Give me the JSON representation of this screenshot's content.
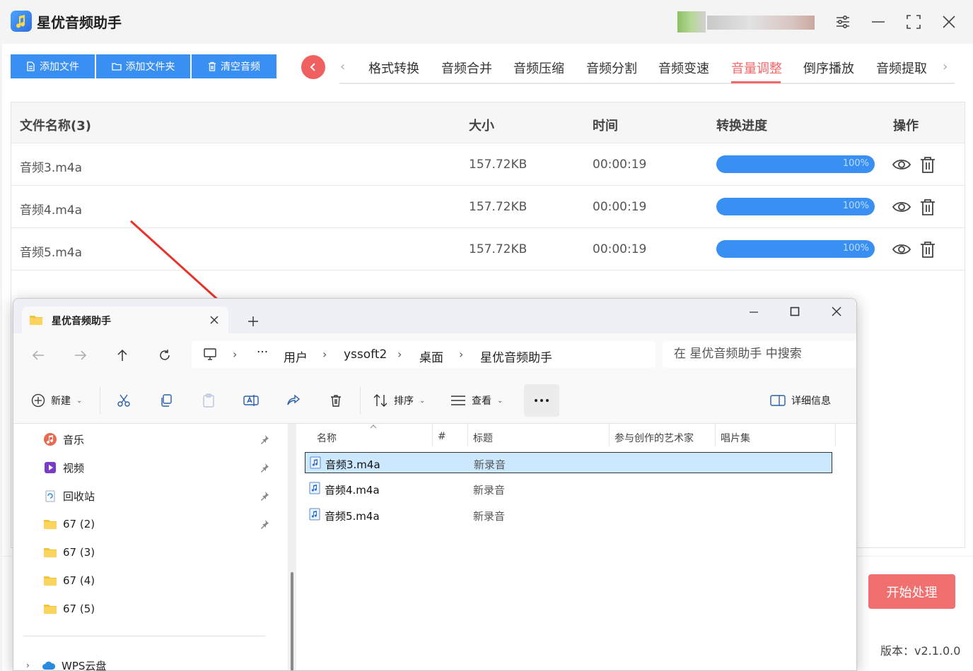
{
  "app": {
    "title": "星优音频助手",
    "toolbar": {
      "add_file": "添加文件",
      "add_folder": "添加文件夹",
      "clear_audio": "清空音频"
    },
    "tabs": [
      "格式转换",
      "音频合并",
      "音频压缩",
      "音频分割",
      "音频变速",
      "音量调整",
      "倒序播放",
      "音频提取"
    ],
    "active_tab": "音量调整",
    "table": {
      "headers": {
        "name": "文件名称(3)",
        "size": "大小",
        "time": "时间",
        "progress": "转换进度",
        "actions": "操作"
      },
      "rows": [
        {
          "name": "音频3.m4a",
          "size": "157.72KB",
          "time": "00:00:19",
          "progress_text": "100%",
          "progress": 1.0
        },
        {
          "name": "音频4.m4a",
          "size": "157.72KB",
          "time": "00:00:19",
          "progress_text": "100%",
          "progress": 1.0
        },
        {
          "name": "音频5.m4a",
          "size": "157.72KB",
          "time": "00:00:19",
          "progress_text": "100%",
          "progress": 1.0
        }
      ]
    },
    "start_button": "开始处理",
    "version": "版本：v2.1.0.0",
    "colors": {
      "primary": "#3a8ff2",
      "accent": "#f06868"
    }
  },
  "explorer": {
    "tab_title": "星优音频助手",
    "breadcrumb": [
      "用户",
      "yssoft2",
      "桌面",
      "星优音频助手"
    ],
    "breadcrumb_ellipsis": "···",
    "search_placeholder": "在 星优音频助手 中搜索",
    "toolbar": {
      "new": "新建",
      "sort": "排序",
      "view": "查看",
      "details": "详细信息"
    },
    "nav_items": [
      {
        "label": "音乐",
        "icon": "music-icon",
        "pinned": true
      },
      {
        "label": "视频",
        "icon": "video-icon",
        "pinned": true
      },
      {
        "label": "回收站",
        "icon": "recycle-bin-icon",
        "pinned": true
      },
      {
        "label": "67 (2)",
        "icon": "folder-icon",
        "pinned": true
      },
      {
        "label": "67 (3)",
        "icon": "folder-icon",
        "pinned": false
      },
      {
        "label": "67 (4)",
        "icon": "folder-icon",
        "pinned": false
      },
      {
        "label": "67 (5)",
        "icon": "folder-icon",
        "pinned": false
      }
    ],
    "nav_cloud": "WPS云盘",
    "columns": [
      "名称",
      "#",
      "标题",
      "参与创作的艺术家",
      "唱片集"
    ],
    "files": [
      {
        "name": "音频3.m4a",
        "title": "新录音",
        "selected": true
      },
      {
        "name": "音频4.m4a",
        "title": "新录音",
        "selected": false
      },
      {
        "name": "音频5.m4a",
        "title": "新录音",
        "selected": false
      }
    ]
  }
}
